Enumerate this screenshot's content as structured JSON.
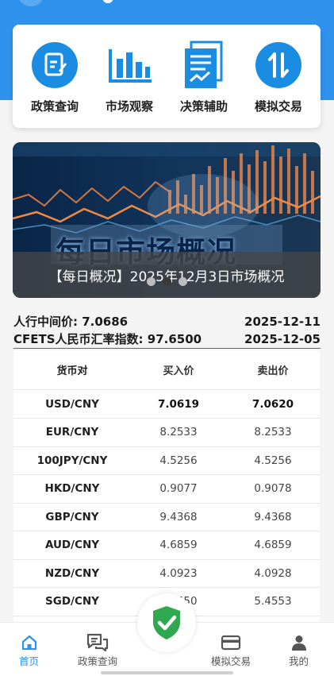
{
  "quick_menu": [
    {
      "label": "政策查询",
      "icon": "policy-search-icon"
    },
    {
      "label": "市场观察",
      "icon": "bar-chart-icon"
    },
    {
      "label": "决策辅助",
      "icon": "document-chart-icon"
    },
    {
      "label": "模拟交易",
      "icon": "exchange-arrows-icon"
    }
  ],
  "banner": {
    "image_text": "每日市场概况",
    "caption": "【每日概况】2025年12月3日市场概况",
    "page_count": 3,
    "active_page": 2
  },
  "rates": {
    "central_parity_label": "人行中间价: 7.0686",
    "central_parity_date": "2025-12-11",
    "cfets_label": "CFETS人民币汇率指数: 97.6500",
    "cfets_date": "2025-12-05"
  },
  "table": {
    "headers": [
      "货币对",
      "买入价",
      "卖出价"
    ],
    "rows": [
      [
        "USD/CNY",
        "7.0619",
        "7.0620"
      ],
      [
        "EUR/CNY",
        "8.2533",
        "8.2533"
      ],
      [
        "100JPY/CNY",
        "4.5256",
        "4.5256"
      ],
      [
        "HKD/CNY",
        "0.9077",
        "0.9078"
      ],
      [
        "GBP/CNY",
        "9.4368",
        "9.4368"
      ],
      [
        "AUD/CNY",
        "4.6859",
        "4.6859"
      ],
      [
        "NZD/CNY",
        "4.0923",
        "4.0928"
      ],
      [
        "SGD/CNY",
        "5.4550",
        "5.4553"
      ]
    ]
  },
  "tabbar": {
    "items": [
      {
        "label": "首页",
        "icon": "home-icon",
        "active": true
      },
      {
        "label": "政策查询",
        "icon": "chat-bubbles-icon",
        "active": false
      },
      {
        "label": "模拟交易",
        "icon": "card-icon",
        "active": false
      },
      {
        "label": "我的",
        "icon": "person-icon",
        "active": false
      }
    ],
    "center_icon": "shield-check-icon"
  },
  "colors": {
    "primary": "#2f93ee",
    "shield": "#2fa84f"
  }
}
